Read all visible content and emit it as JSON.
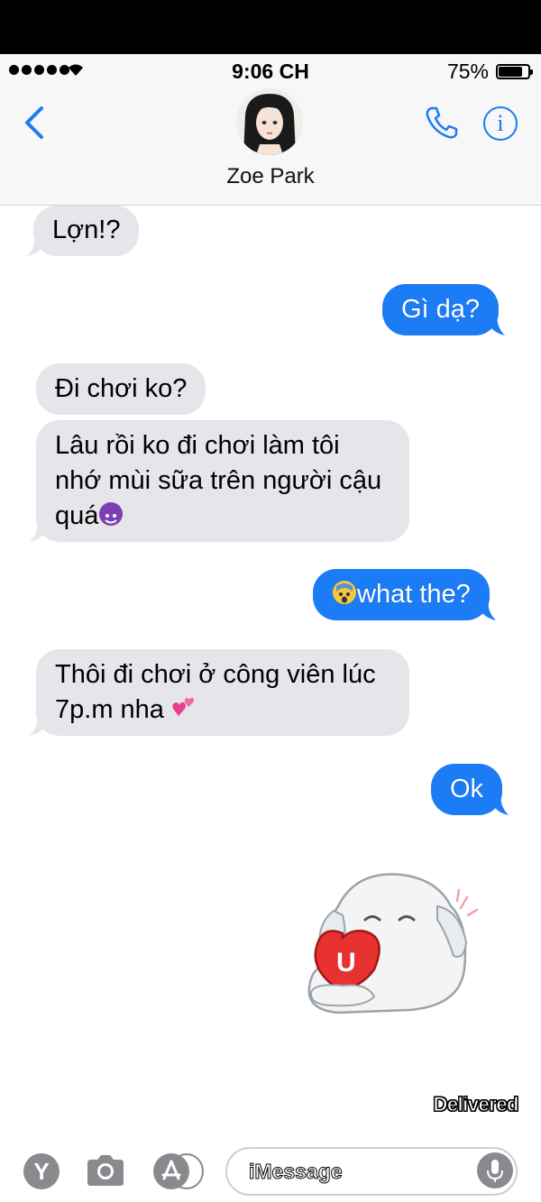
{
  "status": {
    "time": "9:06 CH",
    "battery_percent_label": "75%",
    "battery_level": 0.75
  },
  "header": {
    "contact_name": "Zoe Park",
    "accent_color": "#1a7cf3",
    "info_glyph": "i"
  },
  "messages": [
    {
      "dir": "in",
      "text": "Lợn!?"
    },
    {
      "dir": "out",
      "text": "Gì dạ?"
    },
    {
      "dir": "in",
      "text": "Đi chơi ko?"
    },
    {
      "dir": "in",
      "line1": "Lâu rồi ko đi chơi làm tôi",
      "line2": "nhớ mùi sữa trên người cậu",
      "line3": "quá"
    },
    {
      "dir": "out",
      "text": "what the?"
    },
    {
      "dir": "in",
      "line1": "Thôi đi chơi ở công viên lúc",
      "line2": "7p.m nha"
    },
    {
      "dir": "out",
      "text": "Ok"
    }
  ],
  "sticker_text": "U",
  "delivered_label": "Delivered",
  "composer": {
    "placeholder": "iMessage",
    "y_label": "Y"
  },
  "colors": {
    "incoming_bubble": "#e5e5ea",
    "outgoing_bubble": "#1b7cf5"
  },
  "icons": [
    "back-chevron-icon",
    "phone-icon",
    "info-icon",
    "camera-icon",
    "app-store-icon",
    "microphone-icon"
  ]
}
